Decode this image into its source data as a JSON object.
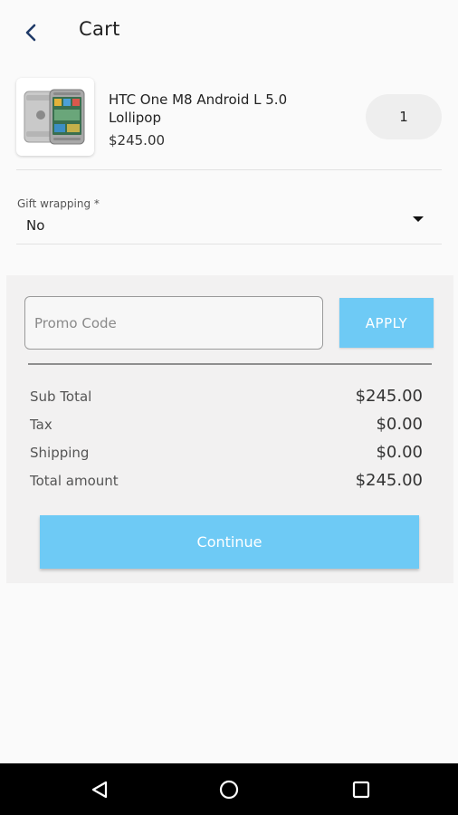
{
  "header": {
    "title": "Cart",
    "back_icon": "chevron-left-icon",
    "accent_color": "#1f3a68"
  },
  "cart_item": {
    "name": "HTC One M8 Android L 5.0 Lollipop",
    "price": "$245.00",
    "quantity": "1",
    "image_icon": "smartphone-icon"
  },
  "gift_wrapping": {
    "label": "Gift wrapping *",
    "value": "No",
    "dropdown_icon": "caret-down-icon"
  },
  "promo": {
    "placeholder": "Promo Code",
    "value": "",
    "apply_label": "APPLY"
  },
  "summary": {
    "rows": [
      {
        "label": "Sub Total",
        "value": "$245.00"
      },
      {
        "label": "Tax",
        "value": "$0.00"
      },
      {
        "label": "Shipping",
        "value": "$0.00"
      },
      {
        "label": "Total amount",
        "value": "$245.00"
      }
    ]
  },
  "actions": {
    "continue_label": "Continue"
  },
  "colors": {
    "button_blue": "#6ecaf5",
    "panel_bg": "#f2f1f1"
  },
  "system_nav": {
    "back_icon": "triangle-back-icon",
    "home_icon": "circle-home-icon",
    "recents_icon": "square-recents-icon"
  }
}
